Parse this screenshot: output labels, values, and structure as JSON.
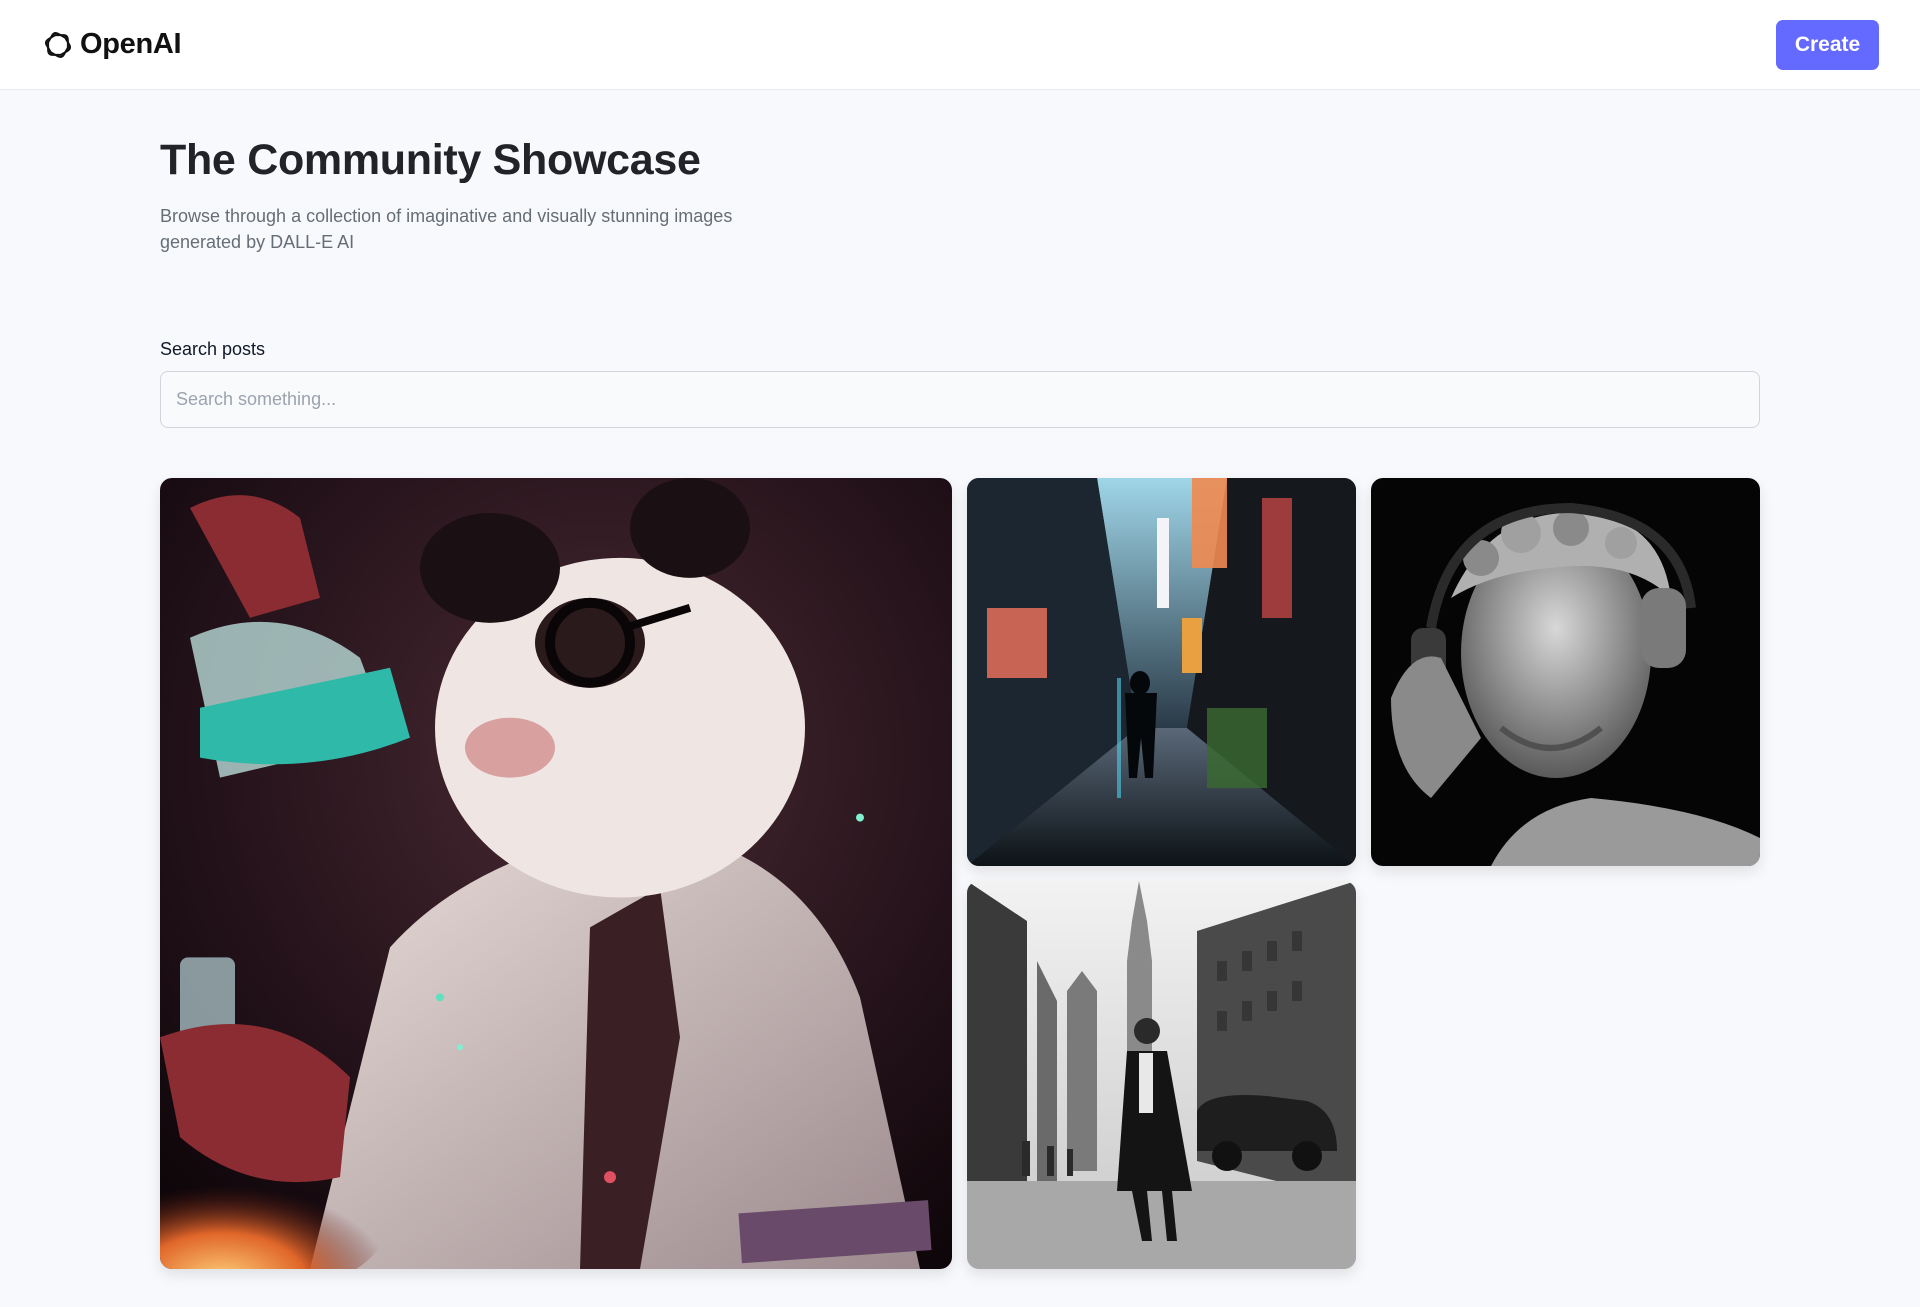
{
  "header": {
    "brand": {
      "name": "OpenAI",
      "icon": "openai-logo-icon"
    },
    "create_label": "Create",
    "accent_color": "#6469ff"
  },
  "page": {
    "title": "The Community Showcase",
    "subtitle": "Browse through a collection of imaginative and visually stunning images generated by DALL-E AI"
  },
  "search": {
    "label": "Search posts",
    "placeholder": "Search something...",
    "value": ""
  },
  "gallery": {
    "items": [
      {
        "image": "panda-scientist-painting"
      },
      {
        "image": "neon-city-street-walker"
      },
      {
        "image": "statue-with-headphones"
      },
      {
        "image": "black-white-city-man-walking"
      }
    ]
  }
}
